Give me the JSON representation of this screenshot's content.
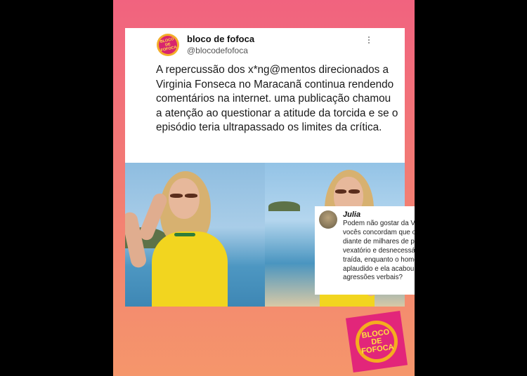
{
  "post": {
    "display_name": "bloco de fofoca",
    "handle": "@blocodefofoca",
    "more_icon": "more-vertical-icon",
    "text": "A repercussão dos x*ng@mentos direcionados a Virginia Fonseca no Maracanã continua rendendo comentários na internet. uma publicação chamou a atenção ao questionar a atitude da torcida e se o episódio teria ultrapassado os limites da crítica."
  },
  "avatar_logo": "BLOCO DE FOFOCA",
  "comment": {
    "author": "Julia",
    "text": "Podem não gostar da Virginia, mas vocês concordam que o que fizeram, diante de milhares de pessoas, foi vexatório e desnecessário? A moça foi traída, enquanto o homem foi aplaudido e ela acabou sendo alvo de agressões verbais?"
  },
  "footer_logo": "BLOCO DE FOFOCA",
  "colors": {
    "background_top": "#f1637f",
    "background_bottom": "#f5966b",
    "brand_pink": "#e2267a",
    "brand_yellow": "#f5ad1f"
  }
}
